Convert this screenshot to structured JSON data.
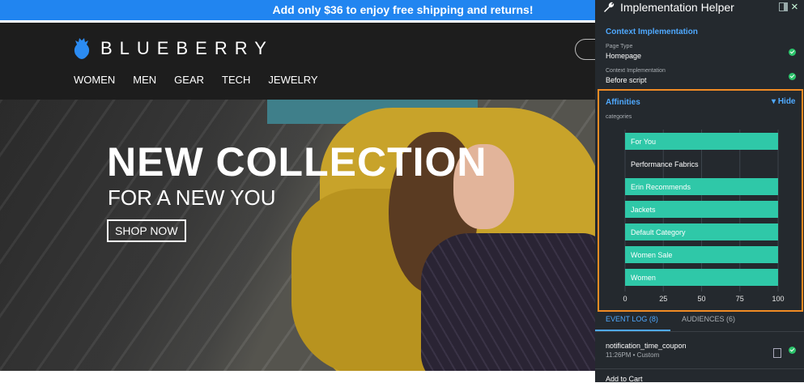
{
  "promo": {
    "text": "Add only $36 to enjoy free shipping and returns!"
  },
  "store": {
    "logo_text": "BLUEBERRY",
    "nav": [
      "WOMEN",
      "MEN",
      "GEAR",
      "TECH",
      "JEWELRY"
    ],
    "hero": {
      "title": "NEW COLLECTION",
      "subtitle": "FOR A NEW YOU",
      "cta": "SHOP NOW"
    }
  },
  "panel": {
    "title": "Implementation Helper",
    "context": {
      "title": "Context Implementation",
      "page_type_label": "Page Type",
      "page_type_value": "Homepage",
      "impl_label": "Context Implementation",
      "impl_value": "Before script"
    },
    "affinities": {
      "title": "Affinities",
      "hide_label": "Hide",
      "sub_label": "categories"
    },
    "tabs": {
      "event_log": "EVENT LOG (8)",
      "audiences": "AUDIENCES (6)"
    },
    "events": [
      {
        "name": "notification_time_coupon",
        "meta": "11:26PM • Custom"
      },
      {
        "name": "Add to Cart",
        "meta": ""
      }
    ],
    "colors": {
      "accent": "#4fa9ff",
      "ok": "#2cc36b",
      "highlight": "#f08b24",
      "bar": "#2fc8a8"
    }
  },
  "chart_data": {
    "type": "bar",
    "orientation": "horizontal",
    "categories": [
      "For You",
      "Performance Fabrics",
      "Erin Recommends",
      "Jackets",
      "Default Category",
      "Women Sale",
      "Women"
    ],
    "values": [
      100,
      0,
      100,
      100,
      100,
      100,
      100
    ],
    "xlim": [
      0,
      100
    ],
    "xticks": [
      0,
      25,
      50,
      75,
      100
    ],
    "grid": true
  }
}
